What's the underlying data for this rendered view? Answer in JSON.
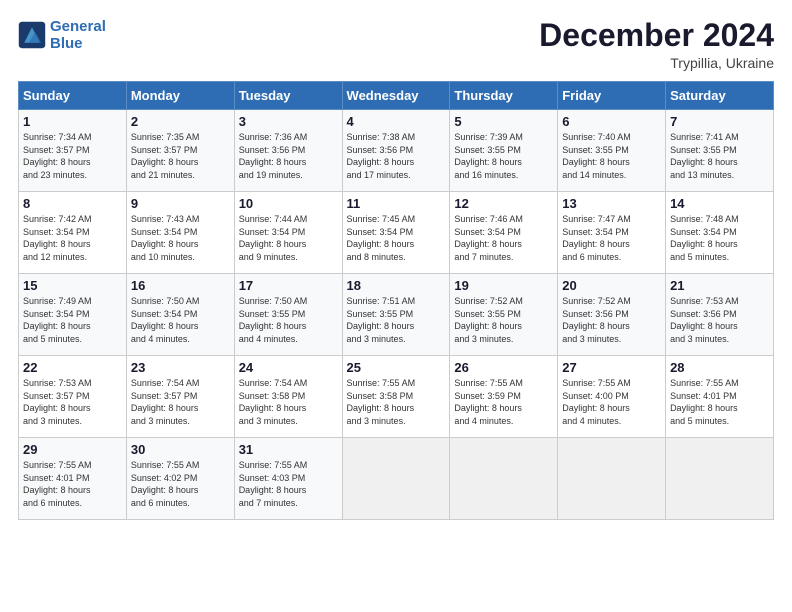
{
  "header": {
    "logo_line1": "General",
    "logo_line2": "Blue",
    "month": "December 2024",
    "location": "Trypillia, Ukraine"
  },
  "days_of_week": [
    "Sunday",
    "Monday",
    "Tuesday",
    "Wednesday",
    "Thursday",
    "Friday",
    "Saturday"
  ],
  "weeks": [
    [
      {
        "day": "1",
        "info": "Sunrise: 7:34 AM\nSunset: 3:57 PM\nDaylight: 8 hours\nand 23 minutes."
      },
      {
        "day": "2",
        "info": "Sunrise: 7:35 AM\nSunset: 3:57 PM\nDaylight: 8 hours\nand 21 minutes."
      },
      {
        "day": "3",
        "info": "Sunrise: 7:36 AM\nSunset: 3:56 PM\nDaylight: 8 hours\nand 19 minutes."
      },
      {
        "day": "4",
        "info": "Sunrise: 7:38 AM\nSunset: 3:56 PM\nDaylight: 8 hours\nand 17 minutes."
      },
      {
        "day": "5",
        "info": "Sunrise: 7:39 AM\nSunset: 3:55 PM\nDaylight: 8 hours\nand 16 minutes."
      },
      {
        "day": "6",
        "info": "Sunrise: 7:40 AM\nSunset: 3:55 PM\nDaylight: 8 hours\nand 14 minutes."
      },
      {
        "day": "7",
        "info": "Sunrise: 7:41 AM\nSunset: 3:55 PM\nDaylight: 8 hours\nand 13 minutes."
      }
    ],
    [
      {
        "day": "8",
        "info": "Sunrise: 7:42 AM\nSunset: 3:54 PM\nDaylight: 8 hours\nand 12 minutes."
      },
      {
        "day": "9",
        "info": "Sunrise: 7:43 AM\nSunset: 3:54 PM\nDaylight: 8 hours\nand 10 minutes."
      },
      {
        "day": "10",
        "info": "Sunrise: 7:44 AM\nSunset: 3:54 PM\nDaylight: 8 hours\nand 9 minutes."
      },
      {
        "day": "11",
        "info": "Sunrise: 7:45 AM\nSunset: 3:54 PM\nDaylight: 8 hours\nand 8 minutes."
      },
      {
        "day": "12",
        "info": "Sunrise: 7:46 AM\nSunset: 3:54 PM\nDaylight: 8 hours\nand 7 minutes."
      },
      {
        "day": "13",
        "info": "Sunrise: 7:47 AM\nSunset: 3:54 PM\nDaylight: 8 hours\nand 6 minutes."
      },
      {
        "day": "14",
        "info": "Sunrise: 7:48 AM\nSunset: 3:54 PM\nDaylight: 8 hours\nand 5 minutes."
      }
    ],
    [
      {
        "day": "15",
        "info": "Sunrise: 7:49 AM\nSunset: 3:54 PM\nDaylight: 8 hours\nand 5 minutes."
      },
      {
        "day": "16",
        "info": "Sunrise: 7:50 AM\nSunset: 3:54 PM\nDaylight: 8 hours\nand 4 minutes."
      },
      {
        "day": "17",
        "info": "Sunrise: 7:50 AM\nSunset: 3:55 PM\nDaylight: 8 hours\nand 4 minutes."
      },
      {
        "day": "18",
        "info": "Sunrise: 7:51 AM\nSunset: 3:55 PM\nDaylight: 8 hours\nand 3 minutes."
      },
      {
        "day": "19",
        "info": "Sunrise: 7:52 AM\nSunset: 3:55 PM\nDaylight: 8 hours\nand 3 minutes."
      },
      {
        "day": "20",
        "info": "Sunrise: 7:52 AM\nSunset: 3:56 PM\nDaylight: 8 hours\nand 3 minutes."
      },
      {
        "day": "21",
        "info": "Sunrise: 7:53 AM\nSunset: 3:56 PM\nDaylight: 8 hours\nand 3 minutes."
      }
    ],
    [
      {
        "day": "22",
        "info": "Sunrise: 7:53 AM\nSunset: 3:57 PM\nDaylight: 8 hours\nand 3 minutes."
      },
      {
        "day": "23",
        "info": "Sunrise: 7:54 AM\nSunset: 3:57 PM\nDaylight: 8 hours\nand 3 minutes."
      },
      {
        "day": "24",
        "info": "Sunrise: 7:54 AM\nSunset: 3:58 PM\nDaylight: 8 hours\nand 3 minutes."
      },
      {
        "day": "25",
        "info": "Sunrise: 7:55 AM\nSunset: 3:58 PM\nDaylight: 8 hours\nand 3 minutes."
      },
      {
        "day": "26",
        "info": "Sunrise: 7:55 AM\nSunset: 3:59 PM\nDaylight: 8 hours\nand 4 minutes."
      },
      {
        "day": "27",
        "info": "Sunrise: 7:55 AM\nSunset: 4:00 PM\nDaylight: 8 hours\nand 4 minutes."
      },
      {
        "day": "28",
        "info": "Sunrise: 7:55 AM\nSunset: 4:01 PM\nDaylight: 8 hours\nand 5 minutes."
      }
    ],
    [
      {
        "day": "29",
        "info": "Sunrise: 7:55 AM\nSunset: 4:01 PM\nDaylight: 8 hours\nand 6 minutes."
      },
      {
        "day": "30",
        "info": "Sunrise: 7:55 AM\nSunset: 4:02 PM\nDaylight: 8 hours\nand 6 minutes."
      },
      {
        "day": "31",
        "info": "Sunrise: 7:55 AM\nSunset: 4:03 PM\nDaylight: 8 hours\nand 7 minutes."
      },
      {
        "day": "",
        "info": ""
      },
      {
        "day": "",
        "info": ""
      },
      {
        "day": "",
        "info": ""
      },
      {
        "day": "",
        "info": ""
      }
    ]
  ]
}
